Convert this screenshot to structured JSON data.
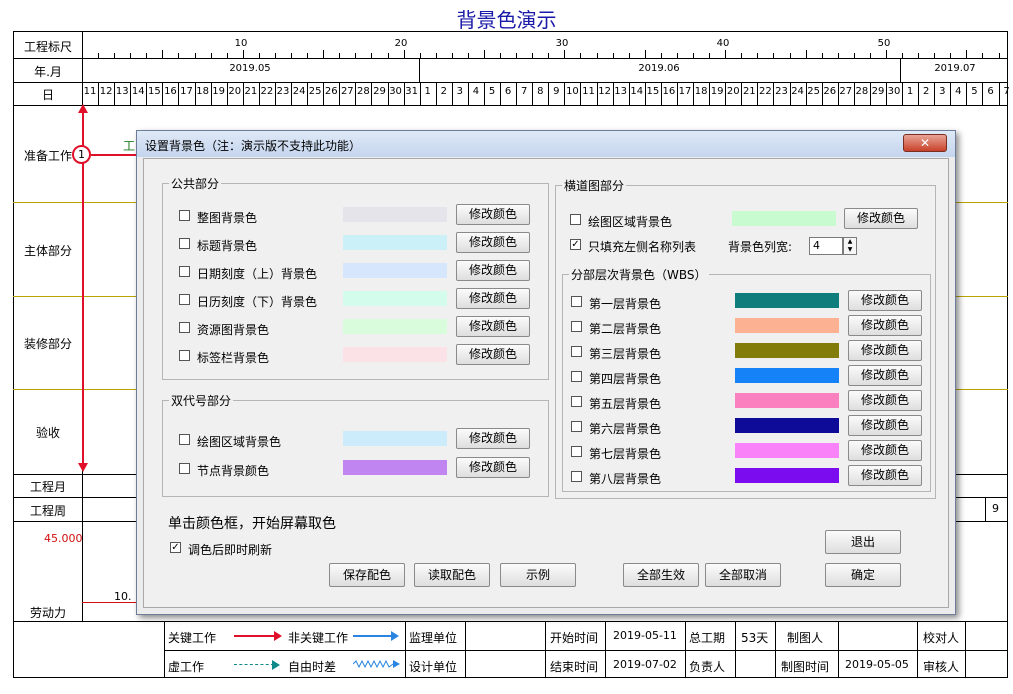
{
  "page_title": "背景色演示",
  "gantt": {
    "row_labels": {
      "scale": "工程标尺",
      "month": "年.月",
      "day": "日",
      "prep": "准备工作",
      "main": "主体部分",
      "decor": "装修部分",
      "accept": "验收",
      "proj_month": "工程月",
      "proj_week": "工程周",
      "labor": "劳动力"
    },
    "scale_ticks": [
      "10",
      "20",
      "30",
      "40",
      "50"
    ],
    "months": [
      "2019.05",
      "2019.06",
      "2019.07"
    ],
    "days_may": [
      "11",
      "12",
      "13",
      "14",
      "15",
      "16",
      "17",
      "18",
      "19",
      "20",
      "21",
      "22",
      "23",
      "24",
      "25",
      "26",
      "27",
      "28",
      "29",
      "30",
      "31"
    ],
    "days_june": [
      "1",
      "2",
      "3",
      "4",
      "5",
      "6",
      "7",
      "8",
      "9",
      "10",
      "11",
      "12",
      "13",
      "14",
      "15",
      "16",
      "17",
      "18",
      "19",
      "20",
      "21",
      "22",
      "23",
      "24",
      "25",
      "26",
      "27",
      "28",
      "29",
      "30"
    ],
    "days_july": [
      "1",
      "2",
      "3",
      "4",
      "5",
      "6",
      "7"
    ],
    "node_label": "1",
    "task_partial": "工",
    "labor_value": "45.000",
    "labor_partial": "10.",
    "week_partial": "9"
  },
  "footer": {
    "critical": "关键工作",
    "noncritical": "非关键工作",
    "supervisor": "监理单位",
    "start_time_label": "开始时间",
    "start_time": "2019-05-11",
    "total_duration_label": "总工期",
    "total_duration": "53天",
    "drafter_label": "制图人",
    "checker_label": "校对人",
    "virtual": "虚工作",
    "free_float": "自由时差",
    "designer": "设计单位",
    "end_time_label": "结束时间",
    "end_time": "2019-07-02",
    "responsible_label": "负责人",
    "draw_time_label": "制图时间",
    "draw_time": "2019-05-05",
    "reviewer_label": "审核人"
  },
  "dialog": {
    "title": "设置背景色（注：演示版不支持此功能）",
    "close_symbol": "✕",
    "public": {
      "title": "公共部分",
      "items": [
        {
          "label": "整图背景色",
          "color": "#e4e4ea"
        },
        {
          "label": "标题背景色",
          "color": "#ccf0f8"
        },
        {
          "label": "日期刻度（上）背景色",
          "color": "#d6e6fc"
        },
        {
          "label": "日历刻度（下）背景色",
          "color": "#d4fced"
        },
        {
          "label": "资源图背景色",
          "color": "#d8fcdc"
        },
        {
          "label": "标签栏背景色",
          "color": "#fbe2e6"
        }
      ]
    },
    "dual": {
      "title": "双代号部分",
      "items": [
        {
          "label": "绘图区域背景色",
          "color": "#ccecfb"
        },
        {
          "label": "节点背景颜色",
          "color": "#c085f0"
        }
      ]
    },
    "gantt_part": {
      "title": "横道图部分",
      "draw_area_label": "绘图区域背景色",
      "draw_area_color": "#c8fcd0",
      "fill_left_label": "只填充左侧名称列表",
      "col_width_label": "背景色列宽:",
      "col_width_value": "4"
    },
    "wbs": {
      "title": "分部层次背景色（WBS）",
      "items": [
        {
          "label": "第一层背景色",
          "color": "#0e7d7c"
        },
        {
          "label": "第二层背景色",
          "color": "#fcb292"
        },
        {
          "label": "第三层背景色",
          "color": "#827d0a"
        },
        {
          "label": "第四层背景色",
          "color": "#1582f7"
        },
        {
          "label": "第五层背景色",
          "color": "#fb80c0"
        },
        {
          "label": "第六层背景色",
          "color": "#0d0b98"
        },
        {
          "label": "第七层背景色",
          "color": "#fa82f9"
        },
        {
          "label": "第八层背景色",
          "color": "#7b0cf0"
        }
      ]
    },
    "modify_label": "修改颜色",
    "hint": "单击颜色框，开始屏幕取色",
    "refresh_label": "调色后即时刷新",
    "save_label": "保存配色",
    "load_label": "读取配色",
    "example_label": "示例",
    "apply_all_label": "全部生效",
    "cancel_all_label": "全部取消",
    "exit_label": "退出",
    "ok_label": "确定"
  }
}
